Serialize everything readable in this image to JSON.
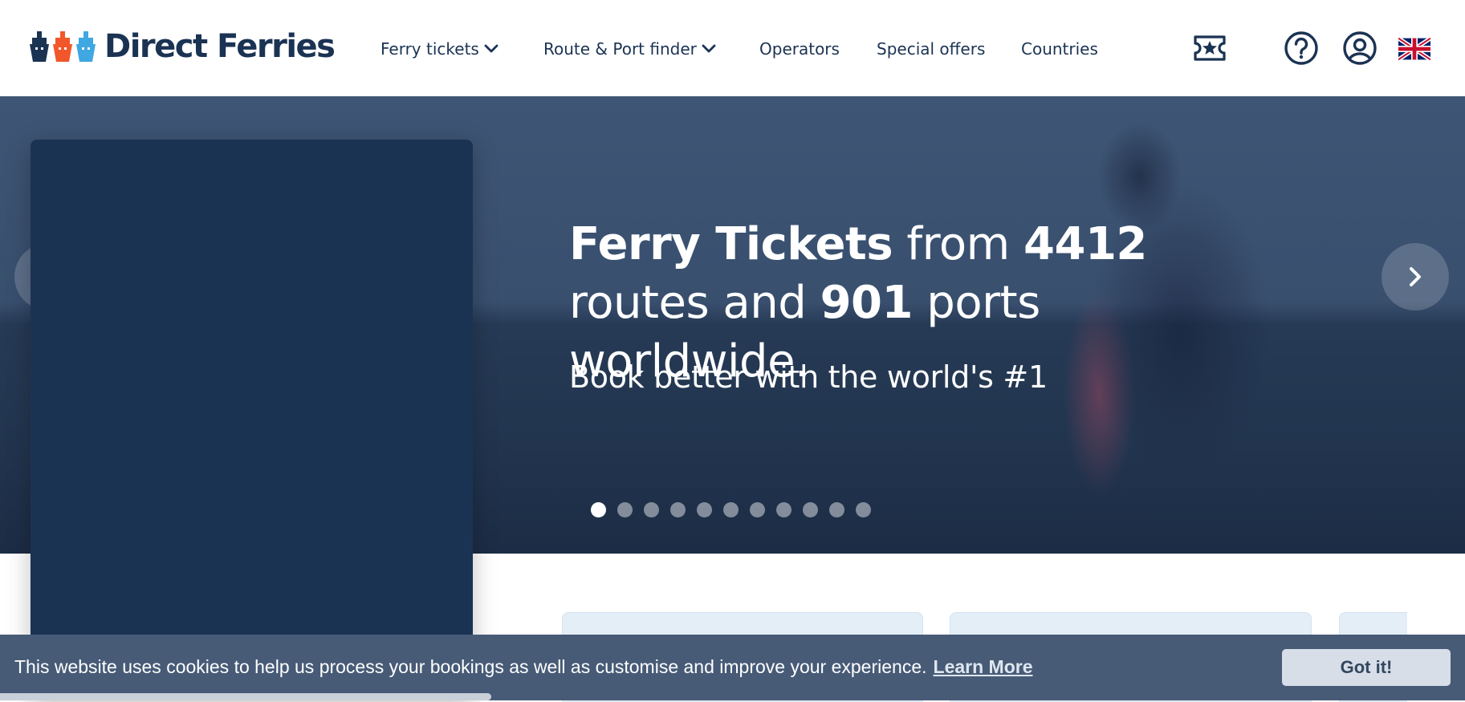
{
  "brand": {
    "name": "Direct Ferries",
    "icon_colors": [
      "#1b3353",
      "#f2562b",
      "#3fa7e1"
    ]
  },
  "nav": {
    "items": [
      {
        "label": "Ferry tickets",
        "has_dropdown": true
      },
      {
        "label": "Route & Port finder",
        "has_dropdown": true
      },
      {
        "label": "Operators",
        "has_dropdown": false
      },
      {
        "label": "Special offers",
        "has_dropdown": false
      },
      {
        "label": "Countries",
        "has_dropdown": false
      }
    ],
    "icons": [
      "ticket-star-icon",
      "help-icon",
      "account-icon",
      "uk-flag-icon"
    ]
  },
  "hero": {
    "headline_bold_1": "Ferry Tickets",
    "headline_text_1": " from ",
    "routes_count": "4412",
    "headline_text_2": " routes and ",
    "ports_count": "901",
    "headline_text_3": " ports worldwide.",
    "subheadline": "Book better with the world's #1",
    "carousel": {
      "slide_count": 11,
      "active_index": 0
    }
  },
  "cookie_bar": {
    "message": "This website uses cookies to help us process your bookings as well as customise and improve your experience.",
    "link_label": "Learn More",
    "button_label": "Got it!"
  },
  "colors": {
    "navy": "#1b3353",
    "cookie_bar": "#475b77",
    "card_bg": "#e3eef7"
  }
}
